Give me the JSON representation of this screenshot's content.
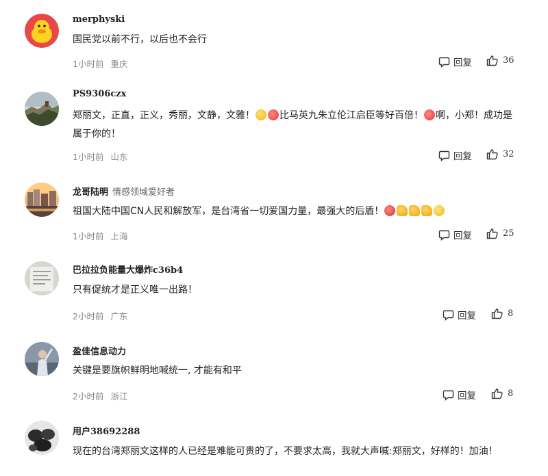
{
  "comments": [
    {
      "username": "merphyski",
      "tag": "",
      "text": "国民党以前不行，以后也不会行",
      "time": "1小时前",
      "location": "重庆",
      "reply_label": "回复",
      "likes": "36",
      "avatar_icon": "duck-avatar-icon"
    },
    {
      "username": "PS9306czx",
      "tag": "",
      "text_part1": "郑丽文，正直，正义，秀丽，文静，文雅！",
      "text_part2": "比马英九朱立伦江启臣等好百倍！",
      "text_part3": "啊，小郑！成功是属于你的！",
      "time": "1小时前",
      "location": "山东",
      "reply_label": "回复",
      "likes": "32",
      "avatar_icon": "great-wall-avatar-icon"
    },
    {
      "username": "龙哥陆明",
      "tag": "情感领域爱好者",
      "text": "祖国大陆中国CN人民和解放军，是台湾省一切爱国力量，最强大的后盾！",
      "time": "1小时前",
      "location": "上海",
      "reply_label": "回复",
      "likes": "25",
      "avatar_icon": "city-avatar-icon"
    },
    {
      "username": "巴拉拉负能量大爆炸c36b4",
      "tag": "",
      "text": "只有促统才是正义唯一出路！",
      "time": "2小时前",
      "location": "广东",
      "reply_label": "回复",
      "likes": "8",
      "avatar_icon": "document-avatar-icon"
    },
    {
      "username": "盈佳信息动力",
      "tag": "",
      "text": "关键是要旗帜鲜明地喊统一, 才能有和平",
      "time": "2小时前",
      "location": "浙江",
      "reply_label": "回复",
      "likes": "8",
      "avatar_icon": "person-avatar-icon"
    },
    {
      "username": "用户38692288",
      "tag": "",
      "text": "现在的台湾郑丽文这样的人已经是难能可贵的了，不要求太高，我就大声喊:郑丽文，好样的！加油！",
      "avatar_icon": "rocks-avatar-icon"
    }
  ],
  "colors": {
    "text": "#222222",
    "meta": "#888888",
    "tag": "#666666"
  }
}
